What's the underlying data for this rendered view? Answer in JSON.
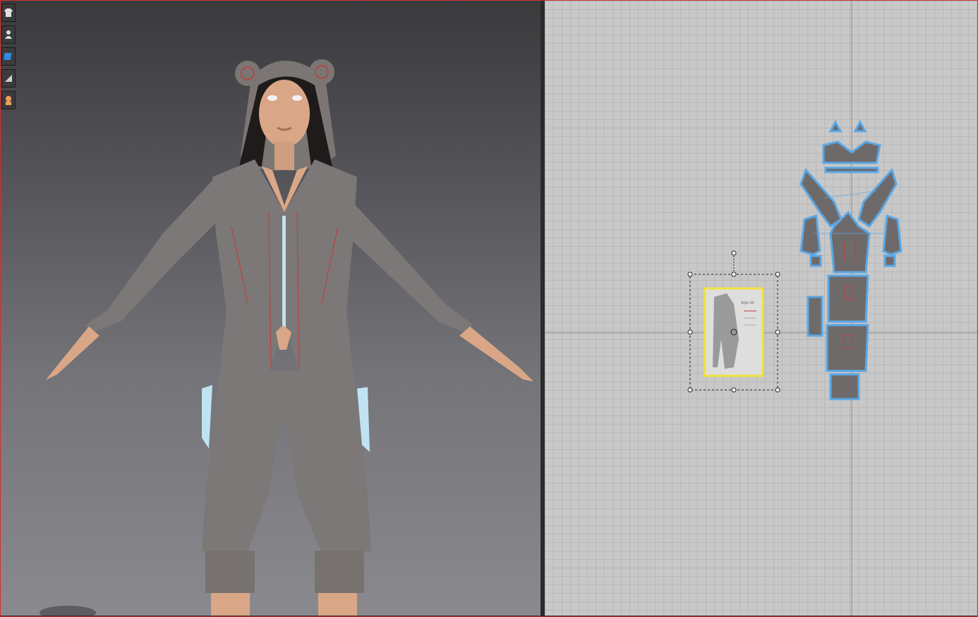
{
  "toolbar": {
    "tools": [
      {
        "icon": "garment-icon"
      },
      {
        "icon": "avatar-icon"
      },
      {
        "icon": "fabric-icon"
      },
      {
        "icon": "simulation-icon"
      },
      {
        "icon": "avatar-skin-icon"
      }
    ]
  },
  "pattern_window": {
    "reference_image_heading": "Style 18"
  },
  "colors": {
    "selection": "#f2e23a",
    "piece_outline": "#5aa8e6",
    "piece_fill": "#6f6a6a",
    "sewing_line": "#c43a3a",
    "zipper": "#bfe3f2"
  }
}
